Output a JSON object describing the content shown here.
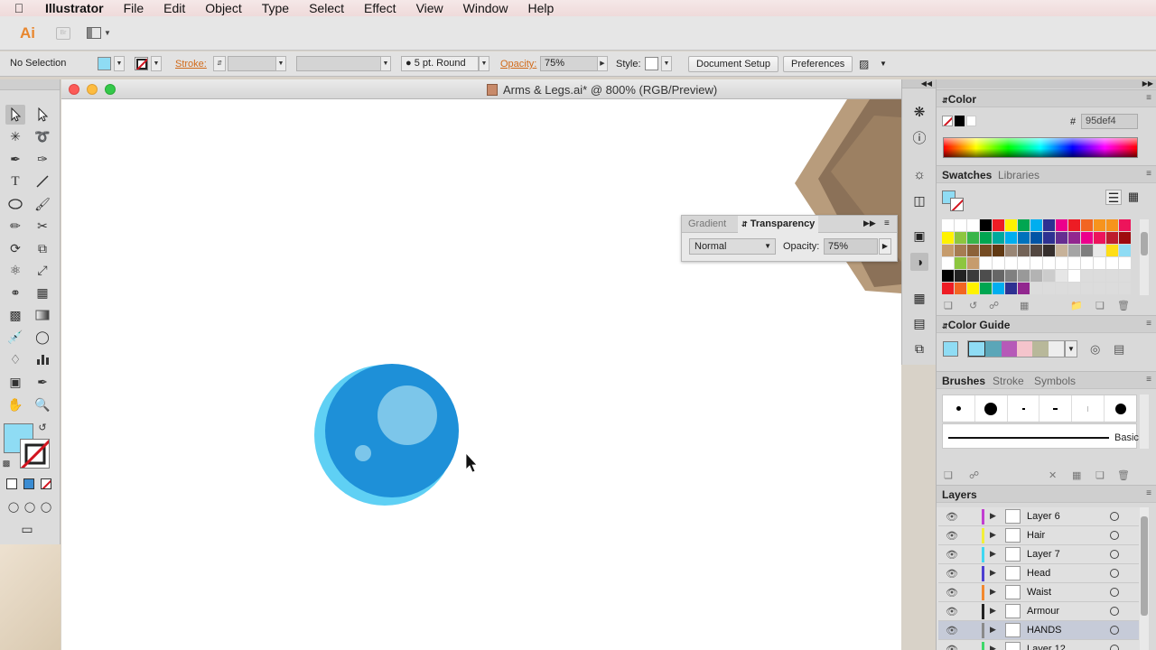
{
  "menubar": {
    "apple_icon": "apple-icon",
    "items": [
      "Illustrator",
      "File",
      "Edit",
      "Object",
      "Type",
      "Select",
      "Effect",
      "View",
      "Window",
      "Help"
    ]
  },
  "appbar": {
    "logo": "Ai",
    "bridge_label": "Br"
  },
  "controlbar": {
    "selection": "No Selection",
    "fill_color": "#8fdcf4",
    "stroke_label": "Stroke:",
    "brush_value": "5 pt. Round",
    "opacity_label": "Opacity:",
    "opacity_value": "75%",
    "style_label": "Style:",
    "document_setup": "Document Setup",
    "preferences": "Preferences"
  },
  "document": {
    "title": "Arms & Legs.ai* @ 800% (RGB/Preview)"
  },
  "transparency_panel": {
    "tab_gradient": "Gradient",
    "tab_transparency": "Transparency",
    "blend_mode": "Normal",
    "opacity_label": "Opacity:",
    "opacity_value": "75%"
  },
  "color_panel": {
    "title": "Color",
    "hex_prefix": "#",
    "hex_value": "95def4"
  },
  "swatches_panel": {
    "tab_swatches": "Swatches",
    "tab_libraries": "Libraries"
  },
  "color_guide_panel": {
    "title": "Color Guide"
  },
  "brushes_panel": {
    "tab_brushes": "Brushes",
    "tab_stroke": "Stroke",
    "tab_symbols": "Symbols",
    "basic_label": "Basic"
  },
  "layers_panel": {
    "title": "Layers",
    "layers": [
      {
        "name": "Layer 6",
        "color": "#c13fd1"
      },
      {
        "name": "Hair",
        "color": "#f2ef3a"
      },
      {
        "name": "Layer 7",
        "color": "#3fd8f2"
      },
      {
        "name": "Head",
        "color": "#4d3fd1"
      },
      {
        "name": "Waist",
        "color": "#f2892f"
      },
      {
        "name": "Armour",
        "color": "#222222"
      },
      {
        "name": "HANDS",
        "color": "#8a8a8a"
      },
      {
        "name": "Layer 12",
        "color": "#3fd86a"
      }
    ]
  },
  "colors": {
    "fill": "#8fdcf4",
    "circle_light": "#5fd0f4",
    "circle_main": "#1e90d8",
    "shape_brown": "#8b7158"
  }
}
